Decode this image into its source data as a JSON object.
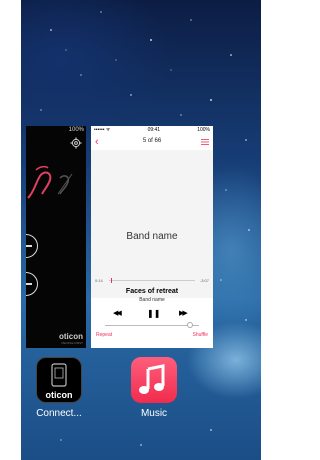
{
  "left_card": {
    "status_time": "",
    "status_battery": "100%",
    "brand": "oticon",
    "brand_sub": "PEOPLE FIRST"
  },
  "right_card": {
    "status_carrier": "•••••• ᯤ",
    "status_time": "09:41",
    "status_battery": "100%",
    "track_counter": "5 of 66",
    "back_symbol": "‹",
    "band_name": "Band name",
    "elapsed": "0:14",
    "remaining": "-3:07",
    "song_title": "Faces of retreat",
    "artist": "Band name",
    "rewind_symbol": "◀◀",
    "pause_symbol": "❚❚",
    "forward_symbol": "▶▶",
    "repeat_label": "Repeat",
    "shuffle_label": "Shuffle",
    "accent_color": "#f0315a"
  },
  "dock": {
    "apps": [
      {
        "label": "Connect...",
        "icon": "oticon-connect-icon",
        "icon_text": "oticon"
      },
      {
        "label": "Music",
        "icon": "music-note-icon"
      }
    ]
  }
}
